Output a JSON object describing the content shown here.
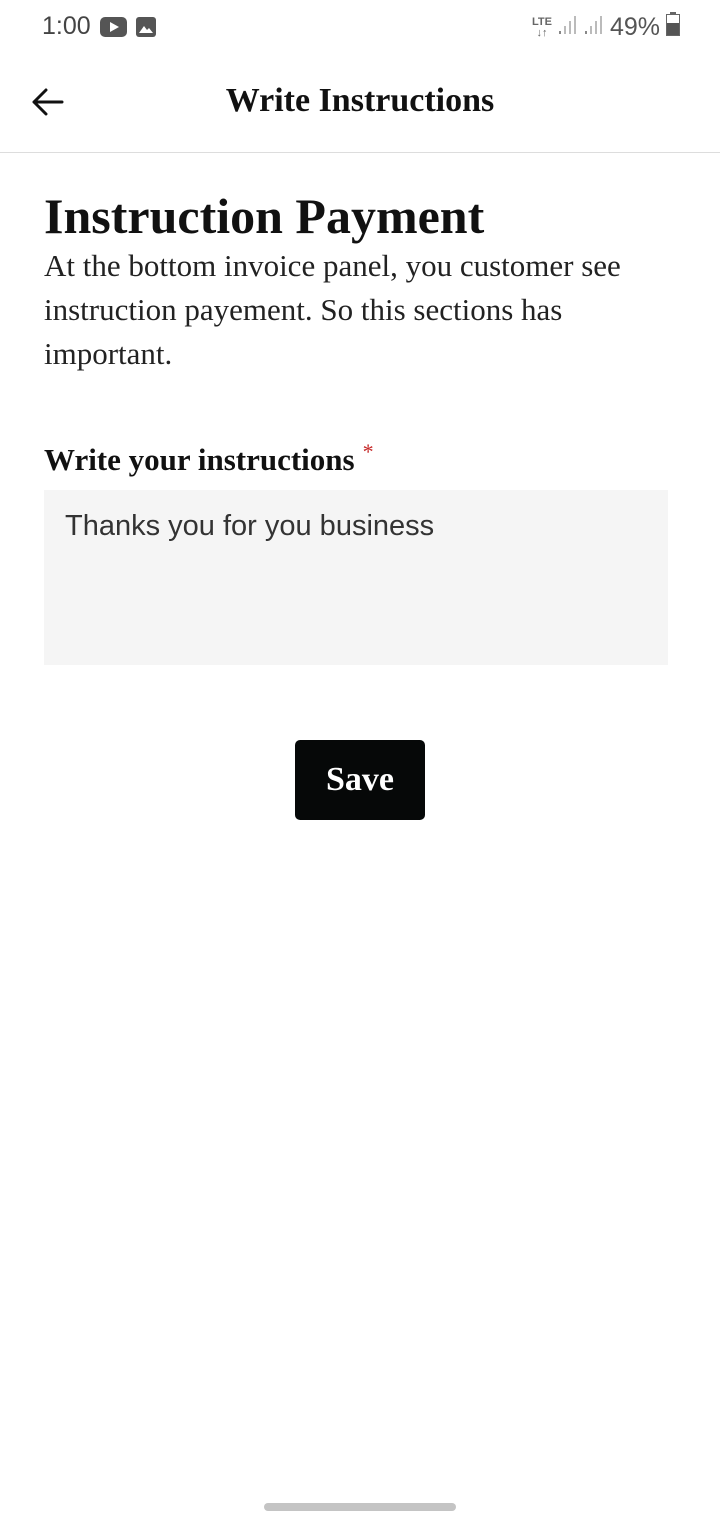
{
  "status_bar": {
    "time": "1:00",
    "network": "LTE",
    "battery": "49%",
    "icons": [
      "youtube-icon",
      "gallery-icon",
      "signal-icon",
      "battery-icon"
    ]
  },
  "app_bar": {
    "back_icon": "arrow-left-icon",
    "title": "Write Instructions"
  },
  "section": {
    "title": "Instruction Payment",
    "description": "At the bottom invoice panel, you customer see instruction payement. So this sections has important."
  },
  "instructions_field": {
    "label": "Write your instructions",
    "required_mark": "*",
    "value": "Thanks you for you business"
  },
  "save_button": {
    "label": "Save"
  },
  "colors": {
    "button_bg": "#060808",
    "input_bg": "#f5f5f5",
    "required": "#c62828"
  }
}
